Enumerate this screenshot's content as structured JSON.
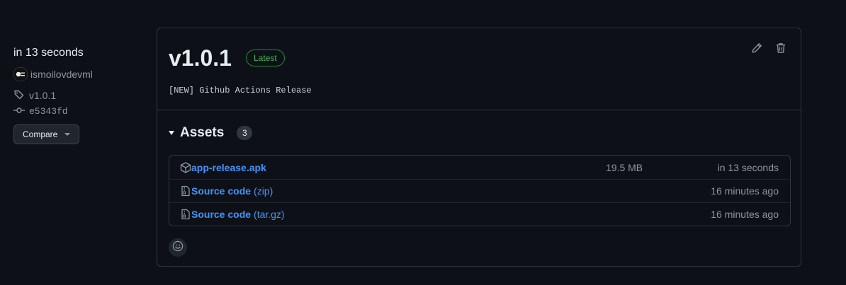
{
  "sidebar": {
    "when": "in 13 seconds",
    "author": "ismoilovdevml",
    "tag": "v1.0.1",
    "commit": "e5343fd",
    "compare_label": "Compare"
  },
  "release": {
    "title": "v1.0.1",
    "badge": "Latest",
    "body": "[NEW] Github Actions Release"
  },
  "assets": {
    "title": "Assets",
    "count": "3",
    "items": [
      {
        "name": "app-release.apk",
        "suffix": "",
        "size": "19.5 MB",
        "date": "in 13 seconds",
        "icon": "package-icon"
      },
      {
        "name": "Source code",
        "suffix": "(zip)",
        "size": "",
        "date": "16 minutes ago",
        "icon": "file-zip-icon"
      },
      {
        "name": "Source code",
        "suffix": "(tar.gz)",
        "size": "",
        "date": "16 minutes ago",
        "icon": "file-zip-icon"
      }
    ]
  },
  "colors": {
    "background": "#0d1117",
    "border": "#30363d",
    "link": "#4493f8",
    "latest": "#3fb950",
    "muted": "#8d96a0"
  }
}
